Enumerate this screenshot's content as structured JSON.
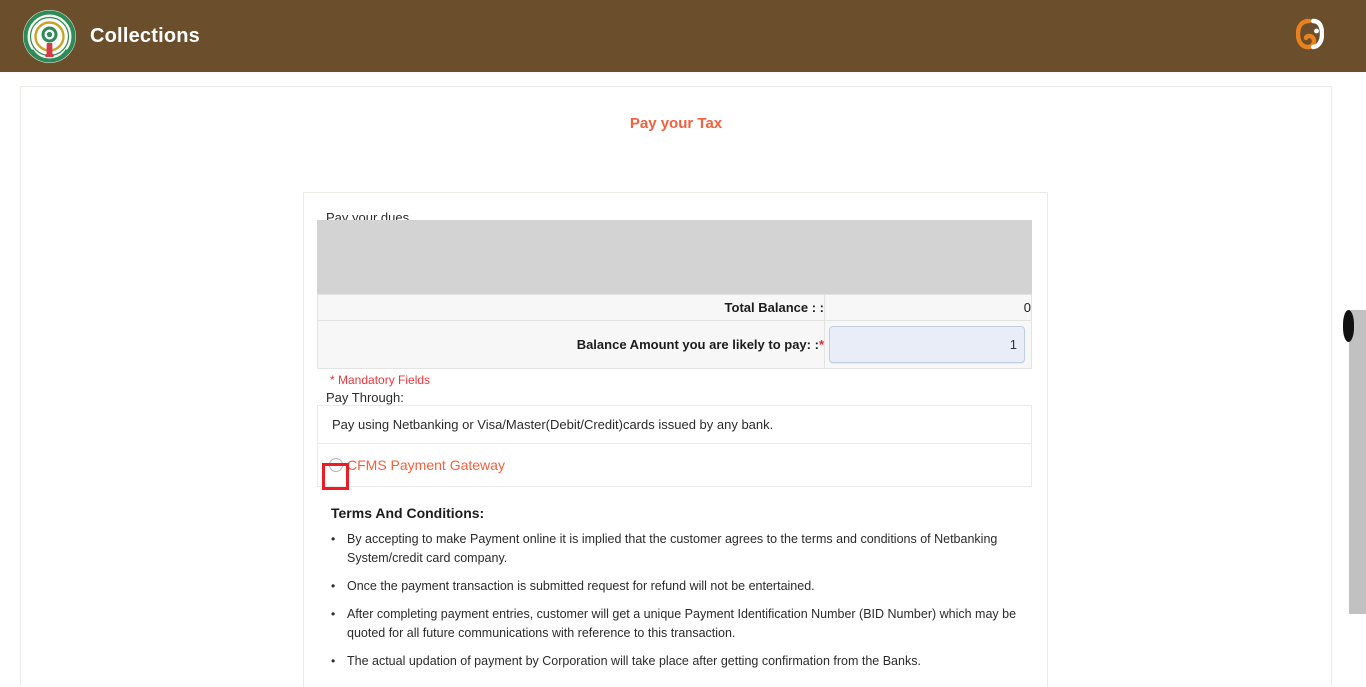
{
  "header": {
    "title": "Collections",
    "emblem_icon": "ap-government-emblem-icon",
    "brand_icon": "e-pragati-brand-icon"
  },
  "page": {
    "title": "Pay your Tax"
  },
  "pay_panel": {
    "legend": "Pay your dues",
    "mandatory_note": "* Mandatory Fields",
    "pay_through_label": "Pay Through:",
    "balance_rows": [
      {
        "label": "Total Balance : :",
        "value": "0",
        "required": false,
        "is_input": false
      },
      {
        "label": "Balance Amount you are likely to pay: :",
        "value": "1",
        "required": true,
        "is_input": true
      }
    ],
    "gateway": {
      "info_text": "Pay using Netbanking or Visa/Master(Debit/Credit)cards issued by any bank.",
      "option_label": "CFMS Payment Gateway",
      "radio_icon": "radio-button-icon",
      "selected": false
    },
    "terms": {
      "heading": "Terms And Conditions:",
      "bullet_glyph": "•",
      "items": [
        "By accepting to make Payment online it is implied that the customer agrees to the terms and conditions of Netbanking System/credit card company.",
        "Once the payment transaction is submitted request for refund will not be entertained.",
        "After completing payment entries, customer will get a unique Payment Identification Number (BID Number) which may be quoted for all future communications with reference to this transaction.",
        "The actual updation of payment by Corporation will take place after getting confirmation from the Banks."
      ]
    }
  },
  "colors": {
    "header_brown": "#6b4f2c",
    "accent_orange": "#f4603c",
    "required_red": "#e8262b",
    "highlight_red": "#ef1b24",
    "mask_gray": "#d3d3d3"
  }
}
